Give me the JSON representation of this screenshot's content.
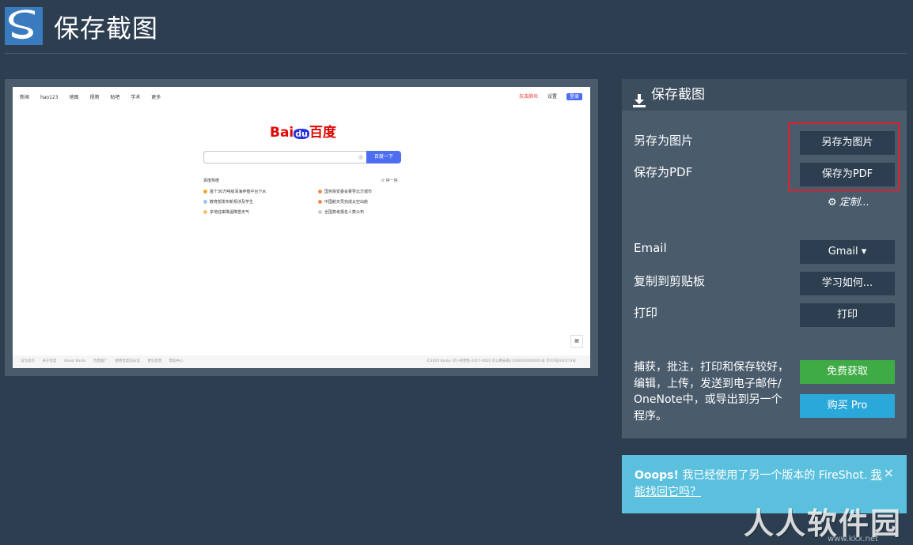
{
  "app": {
    "title": "保存截图",
    "logo_icon": "fireshot-s-logo-icon",
    "background_color": "#2c3e50"
  },
  "preview": {
    "nav": [
      "新闻",
      "hao123",
      "地图",
      "视频",
      "贴吧",
      "学术",
      "更多"
    ],
    "top_right": [
      "抗击肺炎",
      "设置",
      "登录"
    ],
    "logo": {
      "part1": "Bai",
      "du": "du",
      "part2": "百度"
    },
    "search_button": "百度一下",
    "hot_title": "百度热榜",
    "refresh": "换一换",
    "hot_items": [
      "首个30万吨级深海养殖平台下水",
      "国务院安委会督导北方城市",
      "教育部发布新规涉及学生",
      "中国航天员完成太空出舱",
      "多地迎来降温降雪天气",
      "全国高考报名人数公布"
    ],
    "footer_left": [
      "设为首页",
      "关于百度",
      "About Baidu",
      "百度推广",
      "使用百度前必读",
      "意见反馈",
      "帮助中心"
    ],
    "footer_right": "©2020 Baidu (京)-经营性-2017-0020 京公网安备11000002000001号 京ICP证030173号"
  },
  "panel": {
    "header": "保存截图",
    "header_icon": "download-icon",
    "save_image_label": "另存为图片",
    "save_image_button": "另存为图片",
    "save_pdf_label": "保存为PDF",
    "save_pdf_button": "保存为PDF",
    "customize": "定制...",
    "email_label": "Email",
    "email_button": "Gmail ▾",
    "clipboard_label": "复制到剪贴板",
    "clipboard_button": "学习如何...",
    "print_label": "打印",
    "print_button": "打印",
    "description": "捕获，批注，打印和保存较好，编辑，上传，发送到电子邮件/ OneNote中，或导出到另一个程序。",
    "free_button": "免费获取",
    "pro_button": "购买 Pro",
    "highlight_color": "#e0202a",
    "green": "#3fab45",
    "blue": "#2aa8d9"
  },
  "alert": {
    "strong": "Ooops!",
    "text": " 我已经使用了另一个版本的 FireShot. ",
    "link": "我能找回它吗？",
    "close": "×",
    "color": "#5bc0de"
  },
  "watermark": {
    "text": "人人软件园",
    "url": "www.kkx.net"
  }
}
